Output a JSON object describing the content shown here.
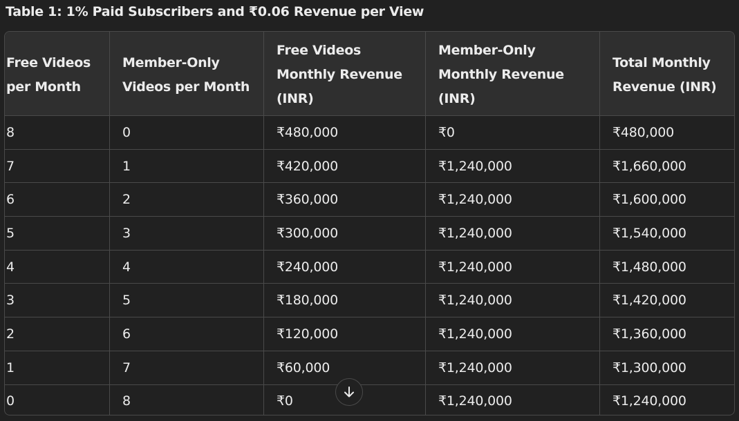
{
  "title": "Table 1: 1% Paid Subscribers and ₹0.06 Revenue per View",
  "table": {
    "headers": [
      "Free Videos per Month",
      "Member-Only Videos per Month",
      "Free Videos Monthly Revenue (INR)",
      "Member-Only Monthly Revenue (INR)",
      "Total Monthly Revenue (INR)"
    ],
    "rows": [
      [
        "8",
        "0",
        "₹480,000",
        "₹0",
        "₹480,000"
      ],
      [
        "7",
        "1",
        "₹420,000",
        "₹1,240,000",
        "₹1,660,000"
      ],
      [
        "6",
        "2",
        "₹360,000",
        "₹1,240,000",
        "₹1,600,000"
      ],
      [
        "5",
        "3",
        "₹300,000",
        "₹1,240,000",
        "₹1,540,000"
      ],
      [
        "4",
        "4",
        "₹240,000",
        "₹1,240,000",
        "₹1,480,000"
      ],
      [
        "3",
        "5",
        "₹180,000",
        "₹1,240,000",
        "₹1,420,000"
      ],
      [
        "2",
        "6",
        "₹120,000",
        "₹1,240,000",
        "₹1,360,000"
      ],
      [
        "1",
        "7",
        "₹60,000",
        "₹1,240,000",
        "₹1,300,000"
      ],
      [
        "0",
        "8",
        "₹0",
        "₹1,240,000",
        "₹1,240,000"
      ]
    ]
  },
  "scroll_button": {
    "icon": "arrow-down-icon"
  },
  "colors": {
    "background": "#212121",
    "header_background": "#2f2f2f",
    "border": "#4a4a4a",
    "text": "#ececec"
  }
}
